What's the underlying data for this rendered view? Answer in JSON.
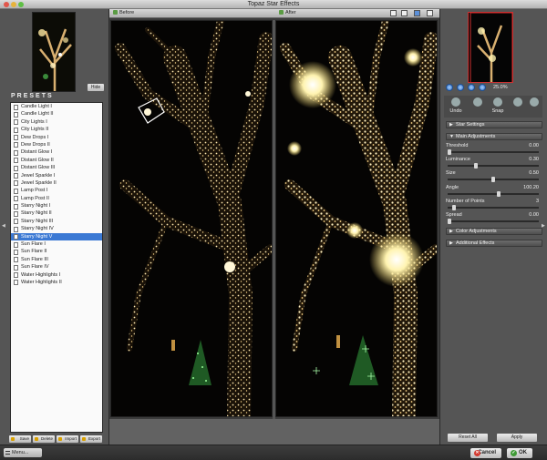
{
  "window": {
    "title": "Topaz Star Effects"
  },
  "left_panel": {
    "hide_label": "Hide",
    "presets_heading": "PRESETS",
    "presets": [
      "Candle Light I",
      "Candle Light II",
      "City Lights I",
      "City Lights II",
      "Dew Drops I",
      "Dew Drops II",
      "Distant Glow I",
      "Distant Glow II",
      "Distant Glow III",
      "Jewel Sparkle I",
      "Jewel Sparkle II",
      "Lamp Post I",
      "Lamp Post II",
      "Starry Night I",
      "Starry Night II",
      "Starry Night III",
      "Starry Night IV",
      "Starry Night V",
      "Sun Flare I",
      "Sun Flare II",
      "Sun Flare III",
      "Sun Flare IV",
      "Water Highlights I",
      "Water Highlights II"
    ],
    "selected_preset_index": 17,
    "buttons": {
      "save": "Save",
      "delete": "Delete",
      "import": "Import",
      "export": "Export"
    }
  },
  "view": {
    "before_label": "Before",
    "after_label": "After"
  },
  "right_panel": {
    "zoom_value": "25.0%",
    "undo_label": "Undo",
    "snap_label": "Snap",
    "sections": {
      "star_settings": "Star Settings",
      "main_adjustments": "Main Adjustments",
      "color_adjustments": "Color Adjustments",
      "additional_effects": "Additional Effects"
    },
    "params": [
      {
        "label": "Threshold",
        "value": "0.00",
        "fraction": 0.0
      },
      {
        "label": "Luminance",
        "value": "0.30",
        "fraction": 0.3
      },
      {
        "label": "Size",
        "value": "0.50",
        "fraction": 0.5
      },
      {
        "label": "Angle",
        "value": "100.20",
        "fraction": 0.56
      },
      {
        "label": "Number of Points",
        "value": "3",
        "fraction": 0.05
      },
      {
        "label": "Spread",
        "value": "0.00",
        "fraction": 0.0
      }
    ],
    "reset_all_label": "Reset All",
    "apply_label": "Apply"
  },
  "bottom": {
    "menu_label": "Menu...",
    "cancel_label": "Cancel",
    "ok_label": "OK"
  },
  "colors": {
    "selection": "#3b79d4",
    "nav_frame": "#d03030",
    "cancel": "#d43a2f",
    "ok": "#3f9b36"
  }
}
